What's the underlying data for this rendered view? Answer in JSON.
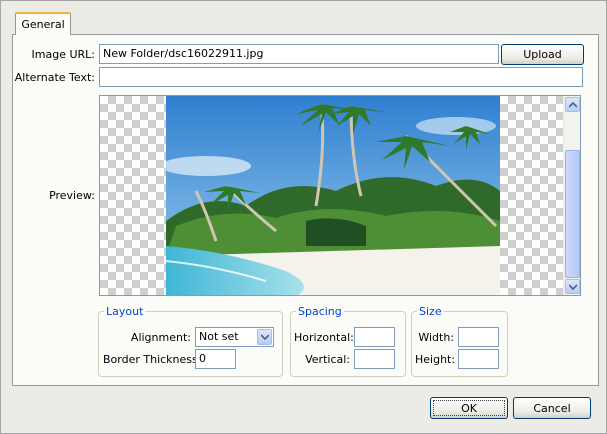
{
  "tabs": [
    {
      "label": "General",
      "active": true
    }
  ],
  "image_url": {
    "label": "Image URL:",
    "value": "New Folder/dsc16022911.jpg"
  },
  "upload_button": "Upload",
  "alternate_text": {
    "label": "Alternate Text:",
    "value": ""
  },
  "preview": {
    "label": "Preview:"
  },
  "layout": {
    "legend": "Layout",
    "alignment_label": "Alignment:",
    "alignment_value": "Not set",
    "border_label": "Border Thickness:",
    "border_value": "0"
  },
  "spacing": {
    "legend": "Spacing",
    "horizontal_label": "Horizontal:",
    "horizontal_value": "",
    "vertical_label": "Vertical:",
    "vertical_value": ""
  },
  "size": {
    "legend": "Size",
    "width_label": "Width:",
    "width_value": "",
    "height_label": "Height:",
    "height_value": ""
  },
  "footer": {
    "ok": "OK",
    "cancel": "Cancel"
  },
  "colors": {
    "legend": "#0046d5",
    "input_border": "#7f9db9",
    "tab_accent": "#f0b33c"
  }
}
